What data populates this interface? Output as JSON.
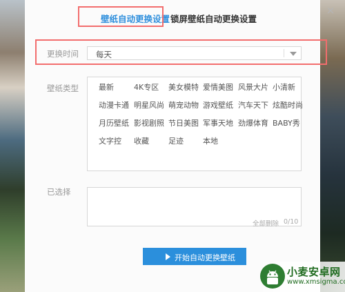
{
  "tabs": {
    "active_label": "壁纸自动更换设置",
    "lock_label": "锁屏壁纸自动更换设置"
  },
  "interval": {
    "label": "更换时间",
    "selected": "每天"
  },
  "wallpaper_types": {
    "label": "壁纸类型",
    "items": [
      "最新",
      "4K专区",
      "美女模特",
      "爱情美图",
      "风景大片",
      "小清新",
      "动漫卡通",
      "明星风尚",
      "萌宠动物",
      "游戏壁纸",
      "汽车天下",
      "炫酷时尚",
      "月历壁纸",
      "影视剧照",
      "节日美图",
      "军事天地",
      "劲爆体育",
      "BABY秀",
      "文字控",
      "收藏",
      "足迹",
      "本地"
    ]
  },
  "selected": {
    "label": "已选择",
    "clear_label": "全部删除",
    "count_text": "0/10"
  },
  "start_button": {
    "label": "开始自动更换壁纸"
  },
  "watermark": {
    "name": "小麦安卓网",
    "url": "www.xmsigma.com"
  },
  "colors": {
    "accent": "#2b8fdc",
    "highlight": "#f26d6d"
  }
}
